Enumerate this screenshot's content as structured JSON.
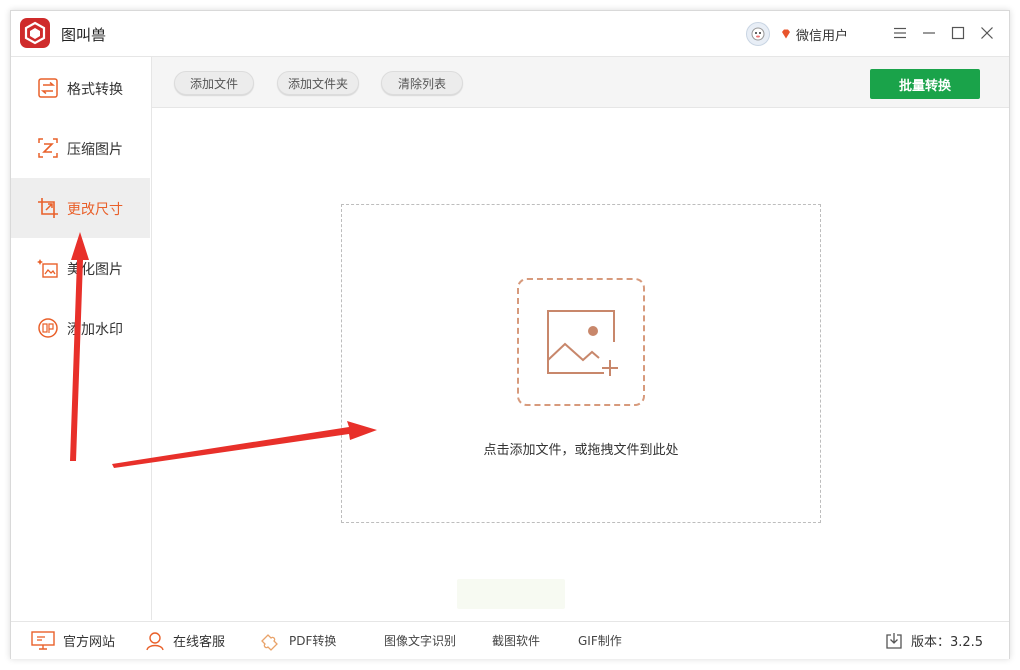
{
  "app": {
    "title": "图叫兽"
  },
  "user": {
    "name": "微信用户"
  },
  "sidebar": {
    "items": [
      {
        "label": "格式转换",
        "icon": "format-convert-icon"
      },
      {
        "label": "压缩图片",
        "icon": "compress-icon"
      },
      {
        "label": "更改尺寸",
        "icon": "resize-crop-icon",
        "active": true
      },
      {
        "label": "美化图片",
        "icon": "beautify-icon"
      },
      {
        "label": "添加水印",
        "icon": "watermark-stamp-icon"
      }
    ]
  },
  "toolbar": {
    "add_file": "添加文件",
    "add_folder": "添加文件夹",
    "clear_list": "清除列表",
    "batch_convert": "批量转换"
  },
  "dropzone": {
    "text": "点击添加文件，或拖拽文件到此处"
  },
  "footer": {
    "website": "官方网站",
    "support": "在线客服",
    "pdf": "PDF转换",
    "ocr": "图像文字识别",
    "screenshot": "截图软件",
    "gif": "GIF制作",
    "version": "版本：3.2.5"
  },
  "colors": {
    "accent": "#e9602a",
    "brand_red": "#cf2b2b",
    "primary_green": "#1aa34a",
    "annotation_arrow": "#e8302a"
  }
}
